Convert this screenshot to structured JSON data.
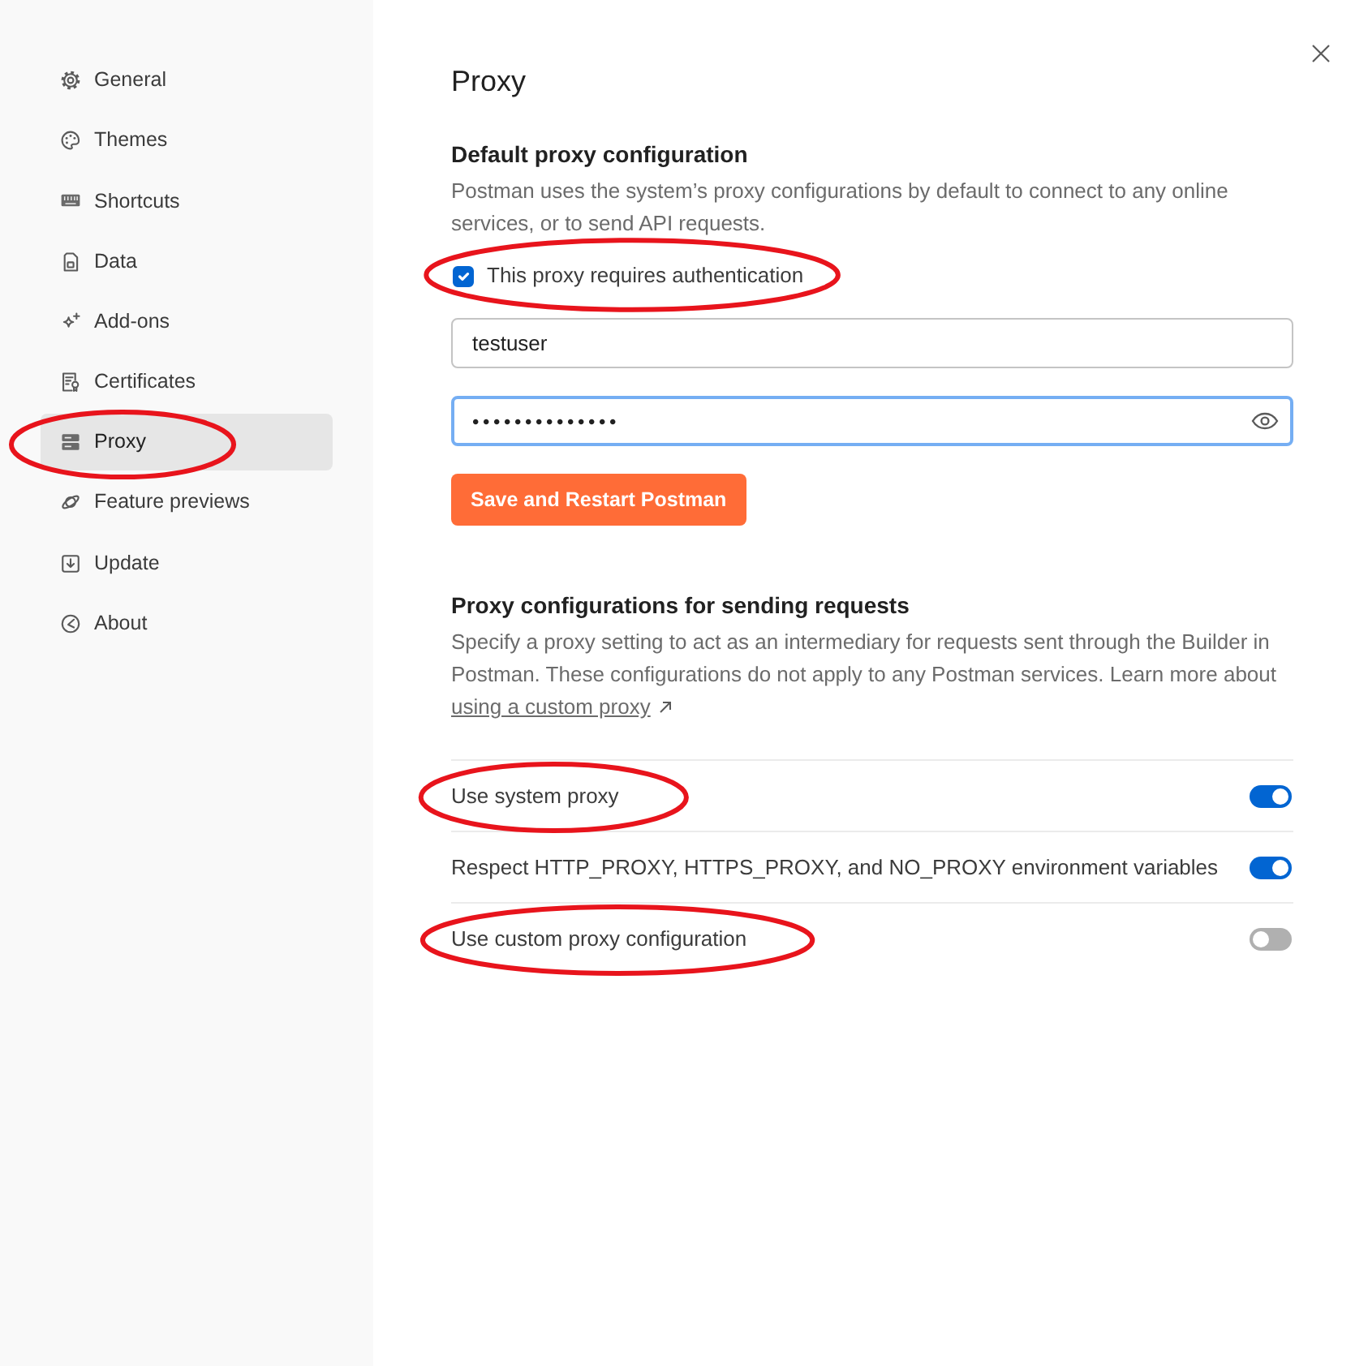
{
  "sidebar": {
    "items": [
      {
        "label": "General",
        "selected": false,
        "circled": false
      },
      {
        "label": "Themes",
        "selected": false,
        "circled": false
      },
      {
        "label": "Shortcuts",
        "selected": false,
        "circled": false
      },
      {
        "label": "Data",
        "selected": false,
        "circled": false
      },
      {
        "label": "Add-ons",
        "selected": false,
        "circled": false
      },
      {
        "label": "Certificates",
        "selected": false,
        "circled": false
      },
      {
        "label": "Proxy",
        "selected": true,
        "circled": true
      },
      {
        "label": "Feature previews",
        "selected": false,
        "circled": false
      },
      {
        "label": "Update",
        "selected": false,
        "circled": false
      },
      {
        "label": "About",
        "selected": false,
        "circled": false
      }
    ]
  },
  "page": {
    "title": "Proxy"
  },
  "default_proxy": {
    "heading": "Default proxy configuration",
    "description": "Postman uses the system’s proxy configurations by default to connect to any online services, or to send API requests.",
    "auth_checkbox": {
      "label": "This proxy requires authentication",
      "checked": true,
      "circled": true
    },
    "username_field": {
      "value": "testuser"
    },
    "password_field": {
      "value": "••••••••••••••",
      "focused": true
    },
    "save_button": {
      "label": "Save and Restart Postman"
    }
  },
  "sending_requests": {
    "heading": "Proxy configurations for sending requests",
    "description": "Specify a proxy setting to act as an intermediary for requests sent through the Builder in Postman. These configurations do not apply to any Postman services. Learn more about",
    "link": {
      "label": "using a custom proxy"
    },
    "settings": [
      {
        "label": "Use system proxy",
        "on": true,
        "circled": true
      },
      {
        "label": "Respect HTTP_PROXY, HTTPS_PROXY, and NO_PROXY environment variables",
        "on": true,
        "circled": false
      },
      {
        "label": "Use custom proxy configuration",
        "on": false,
        "circled": true
      }
    ]
  }
}
